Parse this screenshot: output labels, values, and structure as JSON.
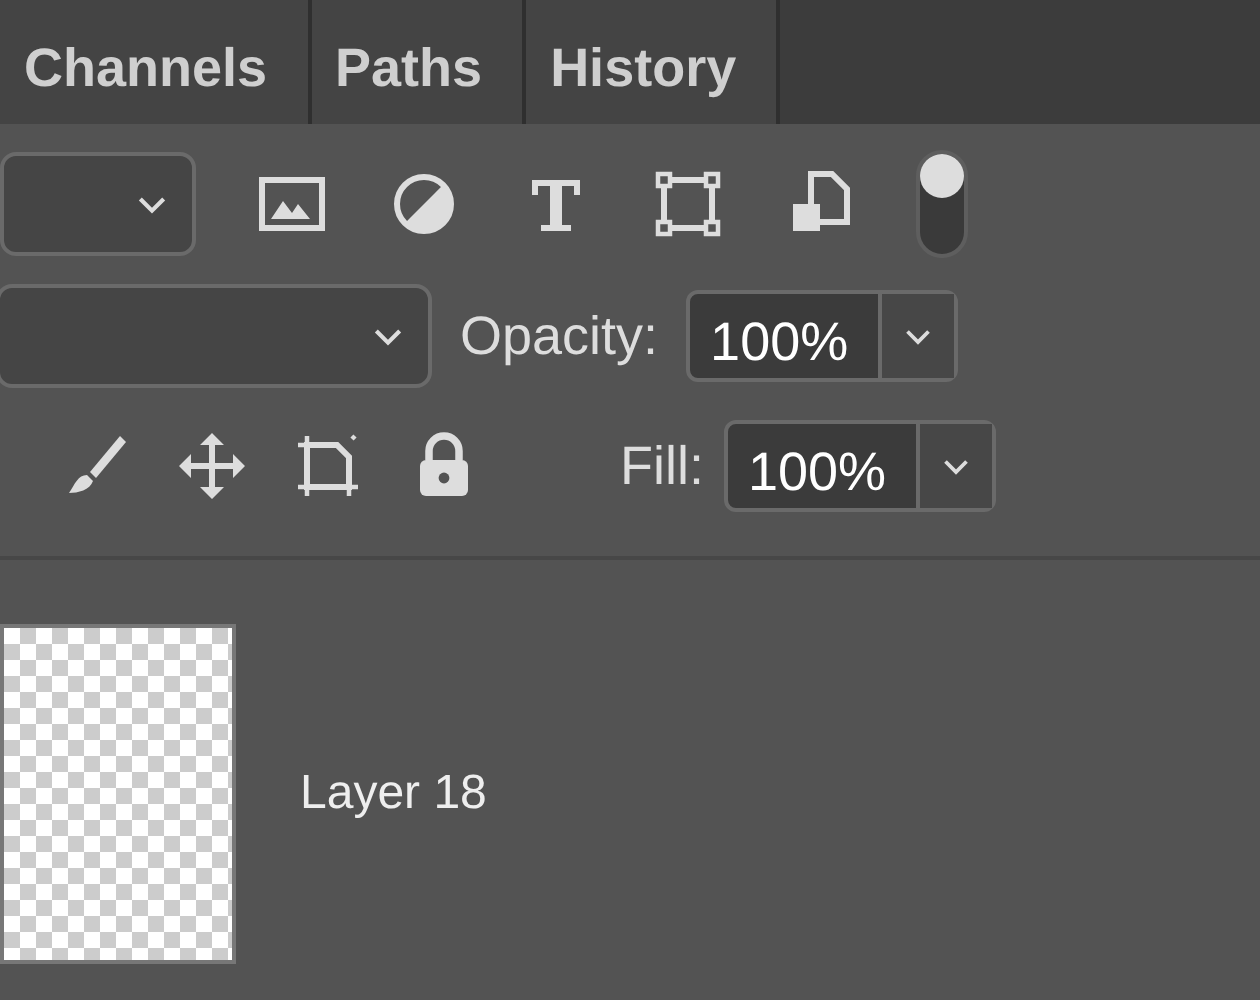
{
  "tabs": [
    {
      "label": "Channels",
      "selected": false
    },
    {
      "label": "Paths",
      "selected": false
    },
    {
      "label": "History",
      "selected": false
    }
  ],
  "filter_toggle": {
    "on": true
  },
  "opacity": {
    "label": "Opacity:",
    "value": "100%"
  },
  "fill": {
    "label": "Fill:",
    "value": "100%"
  },
  "layers": [
    {
      "name": "Layer 18"
    }
  ]
}
